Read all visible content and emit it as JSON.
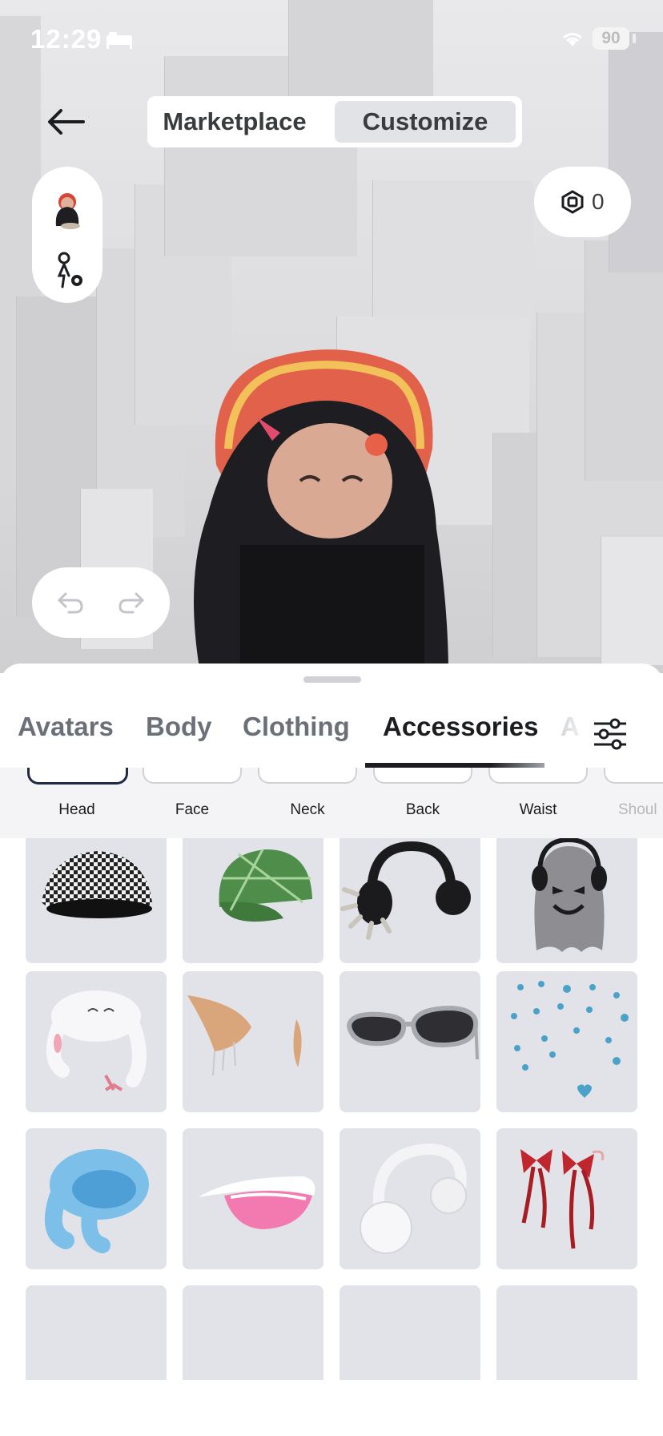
{
  "status_bar": {
    "time": "12:29",
    "battery": "90"
  },
  "header": {
    "modes": [
      {
        "label": "Marketplace",
        "active": false
      },
      {
        "label": "Customize",
        "active": true
      }
    ],
    "robux_balance": "0"
  },
  "category_tabs": [
    {
      "label": "Avatars",
      "active": false
    },
    {
      "label": "Body",
      "active": false
    },
    {
      "label": "Clothing",
      "active": false
    },
    {
      "label": "Accessories",
      "active": true
    },
    {
      "label": "A",
      "active": false
    }
  ],
  "subcategories": [
    {
      "label": "Head",
      "active": true
    },
    {
      "label": "Face",
      "active": false
    },
    {
      "label": "Neck",
      "active": false
    },
    {
      "label": "Back",
      "active": false
    },
    {
      "label": "Waist",
      "active": false
    },
    {
      "label": "Shoul",
      "active": false
    }
  ],
  "items": [
    {
      "icon": "houndstooth-headscarf-icon"
    },
    {
      "icon": "green-plaid-cap-icon"
    },
    {
      "icon": "spiked-headphones-icon"
    },
    {
      "icon": "ghost-headphones-icon"
    },
    {
      "icon": "bunny-hat-icon"
    },
    {
      "icon": "elf-ears-icon"
    },
    {
      "icon": "sunglasses-icon"
    },
    {
      "icon": "floating-hearts-icon"
    },
    {
      "icon": "blue-bunny-ears-hat-icon"
    },
    {
      "icon": "pink-visor-icon"
    },
    {
      "icon": "white-earmuffs-icon"
    },
    {
      "icon": "red-bows-icon"
    },
    {
      "icon": "loading-item-icon"
    },
    {
      "icon": "loading-item-icon"
    },
    {
      "icon": "loading-item-icon"
    },
    {
      "icon": "loading-item-icon"
    }
  ],
  "colors": {
    "accent_dark": "#1b1d21",
    "tile_bg": "#e2e3e8",
    "inactive_tab": "#6b6f78"
  }
}
